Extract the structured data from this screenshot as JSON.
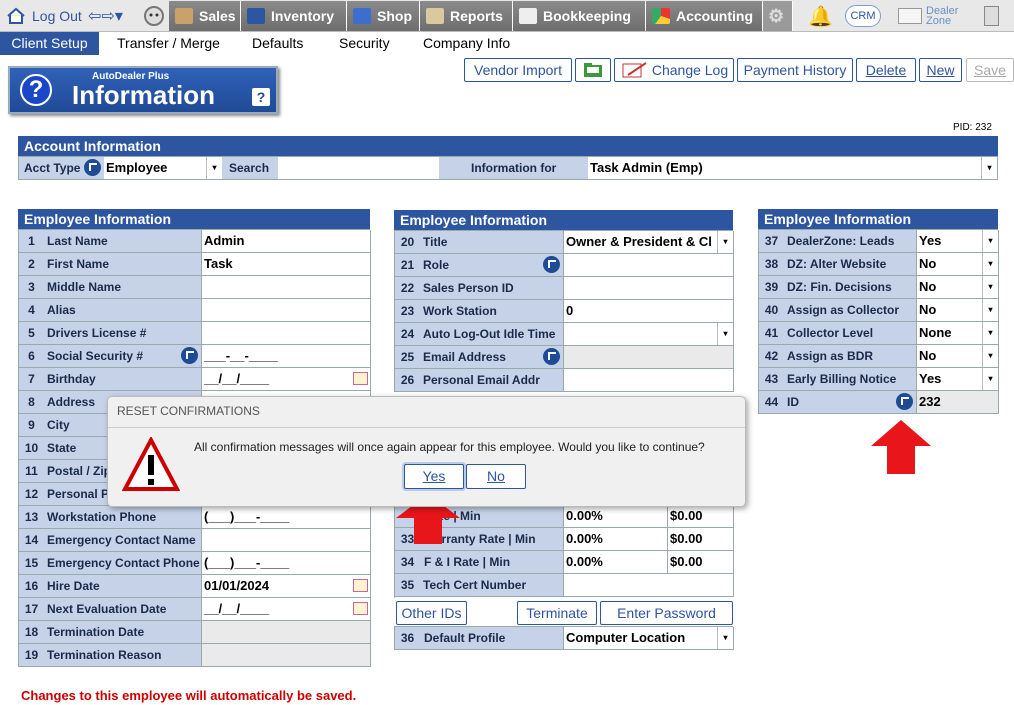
{
  "topbar": {
    "logout": "Log Out",
    "nav": [
      "Sales",
      "Inventory",
      "Shop",
      "Reports",
      "Bookkeeping",
      "Accounting"
    ],
    "crm": "CRM",
    "dealer_zone_1": "Dealer",
    "dealer_zone_2": "Zone"
  },
  "subnav": [
    "Client Setup",
    "Transfer / Merge",
    "Defaults",
    "Security",
    "Company Info"
  ],
  "toolbar": {
    "vendor_import": "Vendor Import",
    "change_log": "Change Log",
    "payment_history": "Payment History",
    "delete": "Delete",
    "new": "New",
    "save": "Save"
  },
  "info_box": {
    "small": "AutoDealer Plus",
    "title": "Information"
  },
  "pid": "PID: 232",
  "account": {
    "header": "Account Information",
    "acct_type_label": "Acct Type",
    "acct_type_value": "Employee",
    "search_label": "Search",
    "search_value": "",
    "info_for_label": "Information for",
    "info_for_value": "Task Admin (Emp)"
  },
  "col1": {
    "header": "Employee Information",
    "rows": [
      {
        "n": "1",
        "label": "Last Name",
        "value": "Admin"
      },
      {
        "n": "2",
        "label": "First Name",
        "value": "Task"
      },
      {
        "n": "3",
        "label": "Middle Name",
        "value": ""
      },
      {
        "n": "4",
        "label": "Alias",
        "value": ""
      },
      {
        "n": "5",
        "label": "Drivers License #",
        "value": ""
      },
      {
        "n": "6",
        "label": "Social Security #",
        "value": "___-__-____"
      },
      {
        "n": "7",
        "label": "Birthday",
        "value": "__/__/____"
      },
      {
        "n": "8",
        "label": "Address",
        "value": ""
      },
      {
        "n": "9",
        "label": "City",
        "value": ""
      },
      {
        "n": "10",
        "label": "State",
        "value": ""
      },
      {
        "n": "11",
        "label": "Postal / Zip",
        "value": ""
      },
      {
        "n": "12",
        "label": "Personal P",
        "value": ""
      },
      {
        "n": "13",
        "label": "Workstation Phone",
        "value": "(___)___-____"
      },
      {
        "n": "14",
        "label": "Emergency Contact Name",
        "value": ""
      },
      {
        "n": "15",
        "label": "Emergency Contact Phone",
        "value": "(___)___-____"
      },
      {
        "n": "16",
        "label": "Hire Date",
        "value": "01/01/2024"
      },
      {
        "n": "17",
        "label": "Next Evaluation Date",
        "value": "__/__/____"
      },
      {
        "n": "18",
        "label": "Termination Date",
        "value": ""
      },
      {
        "n": "19",
        "label": "Termination Reason",
        "value": ""
      }
    ]
  },
  "col2": {
    "header": "Employee Information",
    "rows": [
      {
        "n": "20",
        "label": "Title",
        "value": "Owner & President & Cl"
      },
      {
        "n": "21",
        "label": "Role",
        "value": ""
      },
      {
        "n": "22",
        "label": "Sales Person ID",
        "value": ""
      },
      {
        "n": "23",
        "label": "Work Station",
        "value": "0"
      },
      {
        "n": "24",
        "label": "Auto Log-Out Idle Time",
        "value": ""
      },
      {
        "n": "25",
        "label": "Email Address",
        "value": ""
      },
      {
        "n": "26",
        "label": "Personal Email Addr",
        "value": ""
      }
    ],
    "rates": [
      {
        "n": "",
        "label": "Rate | Min",
        "pct": "0.00%",
        "amt": "$0.00"
      },
      {
        "n": "33",
        "label": "Warranty Rate | Min",
        "pct": "0.00%",
        "amt": "$0.00"
      },
      {
        "n": "34",
        "label": "F & I Rate | Min",
        "pct": "0.00%",
        "amt": "$0.00"
      }
    ],
    "tech_cert": {
      "n": "35",
      "label": "Tech Cert Number",
      "value": ""
    },
    "other_ids": "Other IDs",
    "terminate": "Terminate",
    "enter_password": "Enter Password",
    "default_profile": {
      "n": "36",
      "label": "Default Profile",
      "value": "Computer Location"
    }
  },
  "col3": {
    "header": "Employee Information",
    "rows": [
      {
        "n": "37",
        "label": "DealerZone:  Leads",
        "value": "Yes"
      },
      {
        "n": "38",
        "label": "DZ: Alter Website",
        "value": "No"
      },
      {
        "n": "39",
        "label": "DZ:  Fin. Decisions",
        "value": "No"
      },
      {
        "n": "40",
        "label": "Assign as Collector",
        "value": "No"
      },
      {
        "n": "41",
        "label": "Collector Level",
        "value": "None"
      },
      {
        "n": "42",
        "label": "Assign as BDR",
        "value": "No"
      },
      {
        "n": "43",
        "label": "Early Billing Notice",
        "value": "Yes"
      },
      {
        "n": "44",
        "label": "ID",
        "value": "232"
      }
    ]
  },
  "dialog": {
    "title": "RESET CONFIRMATIONS",
    "message": "All confirmation messages will once again appear for this employee. Would you like to continue?",
    "yes": "Yes",
    "no": "No"
  },
  "footer": "Changes to this employee will automatically be saved.",
  "colors": {
    "accent": "#2d55a0",
    "header": "#2d55a0",
    "label_bg": "#c5d2e8",
    "warn": "#cc0000"
  }
}
